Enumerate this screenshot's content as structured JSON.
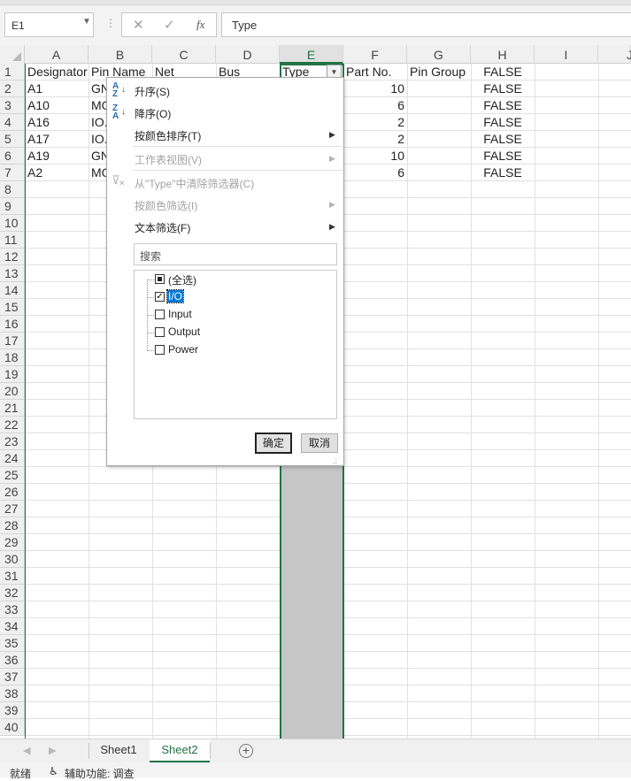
{
  "formula_bar": {
    "name_box": "E1",
    "fx_label": "fx",
    "content": "Type",
    "cancel_icon": "✕",
    "enter_icon": "✓"
  },
  "columns": [
    "A",
    "B",
    "C",
    "D",
    "E",
    "F",
    "G",
    "H",
    "I",
    "J"
  ],
  "selected_column": "E",
  "rows": [
    "1",
    "2",
    "3",
    "4",
    "5",
    "6",
    "7",
    "8",
    "9",
    "10",
    "11",
    "12",
    "13",
    "14",
    "15",
    "16",
    "17",
    "18",
    "19",
    "20",
    "21",
    "22",
    "23",
    "24",
    "25",
    "26",
    "27",
    "28",
    "29",
    "30",
    "31",
    "32",
    "33",
    "34",
    "35",
    "36",
    "37",
    "38",
    "39",
    "40"
  ],
  "cells": {
    "r1": {
      "a": "Designator",
      "b": "Pin Name",
      "c": "Net",
      "d": "Bus",
      "e": "Type",
      "f": "Part No.",
      "g": "Pin Group",
      "h": "FALSE"
    },
    "r2": {
      "a": "A1",
      "b": "GN",
      "f": "10",
      "h": "FALSE"
    },
    "r3": {
      "a": "A10",
      "b": "MO",
      "f": "6",
      "h": "FALSE"
    },
    "r4": {
      "a": "A16",
      "b": "IO.",
      "f": "2",
      "h": "FALSE"
    },
    "r5": {
      "a": "A17",
      "b": "IO.",
      "f": "2",
      "h": "FALSE"
    },
    "r6": {
      "a": "A19",
      "b": "GN",
      "f": "10",
      "h": "FALSE"
    },
    "r7": {
      "a": "A2",
      "b": "MO",
      "f": "6",
      "h": "FALSE"
    }
  },
  "filter_menu": {
    "sort_asc": "升序(S)",
    "sort_desc": "降序(O)",
    "sort_by_color": "按颜色排序(T)",
    "sheet_view": "工作表视图(V)",
    "clear_filter": "从\"Type\"中清除筛选器(C)",
    "filter_by_color": "按颜色筛选(I)",
    "text_filter": "文本筛选(F)",
    "search_placeholder": "搜索",
    "items": [
      {
        "label": "(全选)",
        "state": "partial"
      },
      {
        "label": "I/O",
        "state": "checked"
      },
      {
        "label": "Input",
        "state": "unchecked"
      },
      {
        "label": "Output",
        "state": "unchecked"
      },
      {
        "label": "Power",
        "state": "unchecked"
      }
    ],
    "ok": "确定",
    "cancel": "取消"
  },
  "sheet_tabs": [
    "Sheet1",
    "Sheet2"
  ],
  "active_sheet": "Sheet2",
  "status": {
    "ready": "就绪",
    "accessibility": "辅助功能: 调查"
  },
  "colors": {
    "accent": "#217346",
    "selected_column_fill": "#c6c6c6",
    "highlight": "#0078d7"
  }
}
